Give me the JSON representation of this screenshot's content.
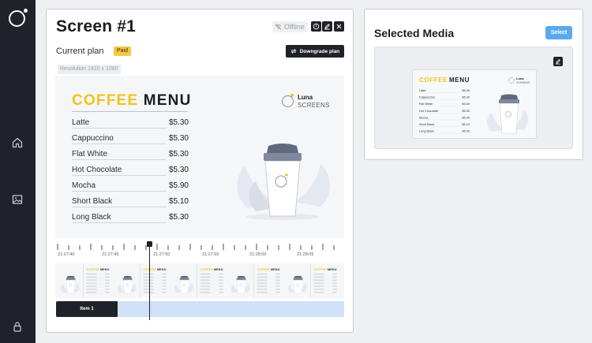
{
  "screen": {
    "title": "Screen #1",
    "status": "Offline",
    "plan_label": "Current plan",
    "plan_badge": "Paid",
    "downgrade_label": "Downgrade plan",
    "resolution": "Resolution 1920 x 1080"
  },
  "menu": {
    "title_word1": "COFFEE",
    "title_word2": "MENU",
    "brand_name": "Luna",
    "brand_sub": "SCREENS",
    "items": [
      {
        "name": "Latte",
        "price": "$5.30"
      },
      {
        "name": "Cappuccino",
        "price": "$5.30"
      },
      {
        "name": "Flat White",
        "price": "$5.30"
      },
      {
        "name": "Hot Chocolate",
        "price": "$5.30"
      },
      {
        "name": "Mocha",
        "price": "$5.90"
      },
      {
        "name": "Short Black",
        "price": "$5.10"
      },
      {
        "name": "Long Black",
        "price": "$5.30"
      }
    ]
  },
  "timeline": {
    "tick_labels": [
      "21:27:40",
      "21:27:45",
      "21:27:50",
      "21:27:55",
      "21:28:00",
      "21:28:05"
    ],
    "item_label": "Item 1"
  },
  "media": {
    "title": "Selected Media",
    "select_label": "Select"
  },
  "colors": {
    "accent_yellow": "#f0c419",
    "sidebar": "#1f2228",
    "select_blue": "#5aa9ee",
    "track_blue": "#cfe2f7"
  }
}
